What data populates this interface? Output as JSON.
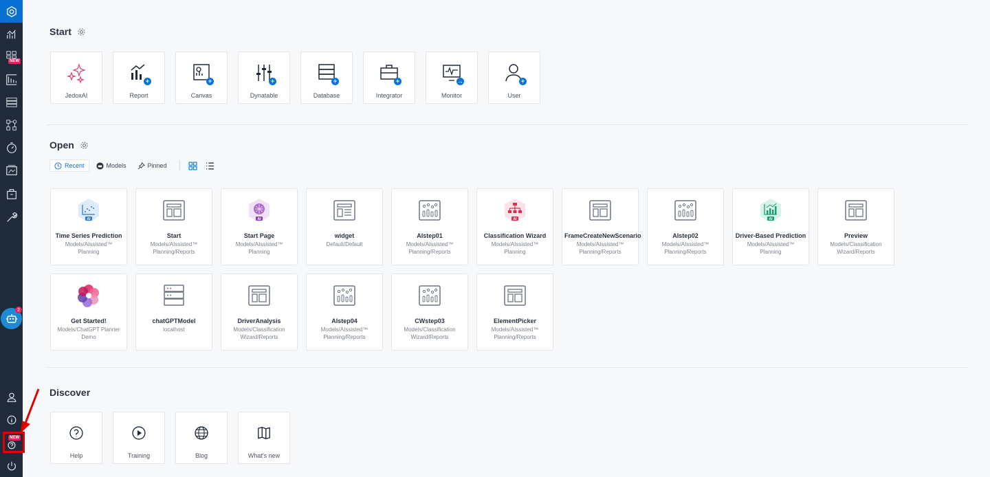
{
  "start": {
    "title": "Start",
    "tiles": [
      {
        "label": "JedoxAI"
      },
      {
        "label": "Report"
      },
      {
        "label": "Canvas"
      },
      {
        "label": "Dynatable"
      },
      {
        "label": "Database"
      },
      {
        "label": "Integrator"
      },
      {
        "label": "Monitor"
      },
      {
        "label": "User"
      }
    ]
  },
  "open": {
    "title": "Open",
    "tabs": [
      {
        "label": "Recent",
        "active": true
      },
      {
        "label": "Models"
      },
      {
        "label": "Pinned"
      }
    ],
    "cards": [
      {
        "title": "Time Series Prediction",
        "path": "Models/AIssisted™ Planning",
        "icon": "ai-chart-icon"
      },
      {
        "title": "Start",
        "path": "Models/AIssisted™ Planning/Reports",
        "icon": "frame-icon"
      },
      {
        "title": "Start Page",
        "path": "Models/AIssisted™ Planning",
        "icon": "ai-brain-icon"
      },
      {
        "title": "widget",
        "path": "Default/Default",
        "icon": "widget-icon"
      },
      {
        "title": "AIstep01",
        "path": "Models/AIssisted™ Planning/Reports",
        "icon": "canvas-icon"
      },
      {
        "title": "Classification Wizard",
        "path": "Models/AIssisted™ Planning",
        "icon": "ai-tree-icon"
      },
      {
        "title": "FrameCreateNewScenario",
        "path": "Models/AIssisted™ Planning/Reports",
        "icon": "frame-icon"
      },
      {
        "title": "AIstep02",
        "path": "Models/AIssisted™ Planning/Reports",
        "icon": "canvas-icon"
      },
      {
        "title": "Driver-Based Prediction",
        "path": "Models/AIssisted™ Planning",
        "icon": "ai-bars-icon"
      },
      {
        "title": "Preview",
        "path": "Models/Classification Wizard/Reports",
        "icon": "frame-icon"
      },
      {
        "title": "Get Started!",
        "path": "Models/ChatGPT Planner Demo",
        "icon": "flower-icon"
      },
      {
        "title": "chatGPTModel",
        "path": "localhost",
        "icon": "database-icon"
      },
      {
        "title": "DriverAnalysis",
        "path": "Models/Classification Wizard/Reports",
        "icon": "frame-icon"
      },
      {
        "title": "AIstep04",
        "path": "Models/AIssisted™ Planning/Reports",
        "icon": "canvas-icon"
      },
      {
        "title": "CWstep03",
        "path": "Models/Classification Wizard/Reports",
        "icon": "canvas-icon"
      },
      {
        "title": "ElementPicker",
        "path": "Models/AIssisted™ Planning/Reports",
        "icon": "frame-icon"
      }
    ]
  },
  "discover": {
    "title": "Discover",
    "tiles": [
      {
        "label": "Help"
      },
      {
        "label": "Training"
      },
      {
        "label": "Blog"
      },
      {
        "label": "What's new"
      }
    ]
  },
  "sidebar": {
    "new_badge": "NEW",
    "bot_count": "2",
    "help_new_badge": "NEW"
  },
  "colors": {
    "sidebar_bg": "#1f2a3a",
    "accent": "#0a6fd2",
    "badge": "#e0245e"
  }
}
